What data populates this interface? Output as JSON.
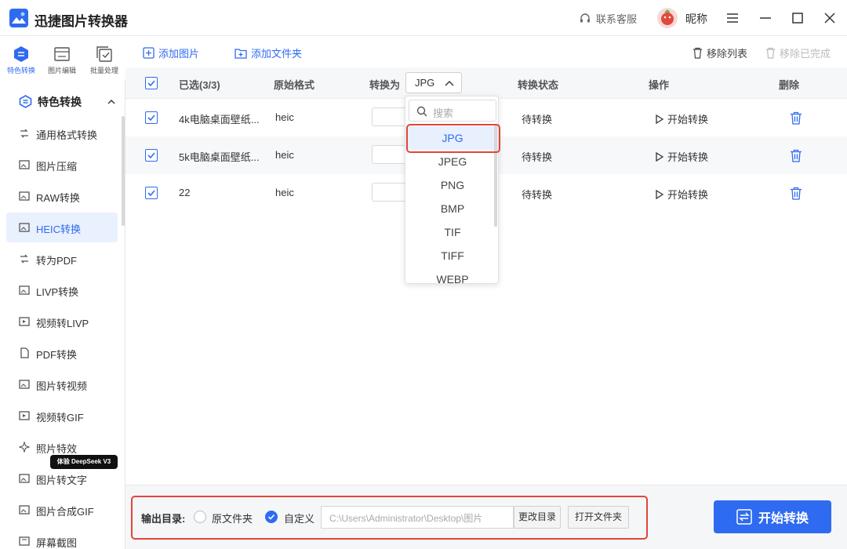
{
  "app": {
    "title": "迅捷图片转换器",
    "support": "联系客服",
    "nickname": "昵称"
  },
  "top_tabs": [
    {
      "label": "特色转换",
      "active": true
    },
    {
      "label": "图片编辑",
      "active": false
    },
    {
      "label": "批量处理",
      "active": false
    }
  ],
  "sidebar": {
    "section": "特色转换",
    "items": [
      {
        "label": "通用格式转换"
      },
      {
        "label": "图片压缩"
      },
      {
        "label": "RAW转换"
      },
      {
        "label": "HEIC转换",
        "active": true
      },
      {
        "label": "转为PDF"
      },
      {
        "label": "LIVP转换"
      },
      {
        "label": "视频转LIVP"
      },
      {
        "label": "PDF转换"
      },
      {
        "label": "图片转视频"
      },
      {
        "label": "视频转GIF"
      },
      {
        "label": "照片特效"
      },
      {
        "label": "图片转文字"
      },
      {
        "label": "图片合成GIF"
      },
      {
        "label": "屏幕截图"
      }
    ],
    "badge": "体验 DeepSeek V3"
  },
  "toolbar": {
    "add_image": "添加图片",
    "add_folder": "添加文件夹",
    "remove_list": "移除列表",
    "remove_done": "移除已完成"
  },
  "table": {
    "headers": {
      "selected": "已选(3/3)",
      "original_format": "原始格式",
      "convert_to": "转换为",
      "status": "转换状态",
      "action": "操作",
      "delete": "删除"
    },
    "selected_format": "JPG",
    "rows": [
      {
        "name": "4k电脑桌面壁纸...",
        "format": "heic",
        "status": "待转换",
        "action": "开始转换"
      },
      {
        "name": "5k电脑桌面壁纸...",
        "format": "heic",
        "status": "待转换",
        "action": "开始转换"
      },
      {
        "name": "22",
        "format": "heic",
        "status": "待转换",
        "action": "开始转换"
      }
    ]
  },
  "dropdown": {
    "search_placeholder": "搜索",
    "options": [
      "JPG",
      "JPEG",
      "PNG",
      "BMP",
      "TIF",
      "TIFF",
      "WEBP"
    ],
    "selected": "JPG"
  },
  "output": {
    "label": "输出目录:",
    "option_original": "原文件夹",
    "option_custom": "自定义",
    "path": "C:\\Users\\Administrator\\Desktop\\图片",
    "change_dir": "更改目录",
    "open_folder": "打开文件夹"
  },
  "start_button": "开始转换",
  "colors": {
    "accent": "#2f6bf0",
    "highlight": "#e0453a"
  }
}
